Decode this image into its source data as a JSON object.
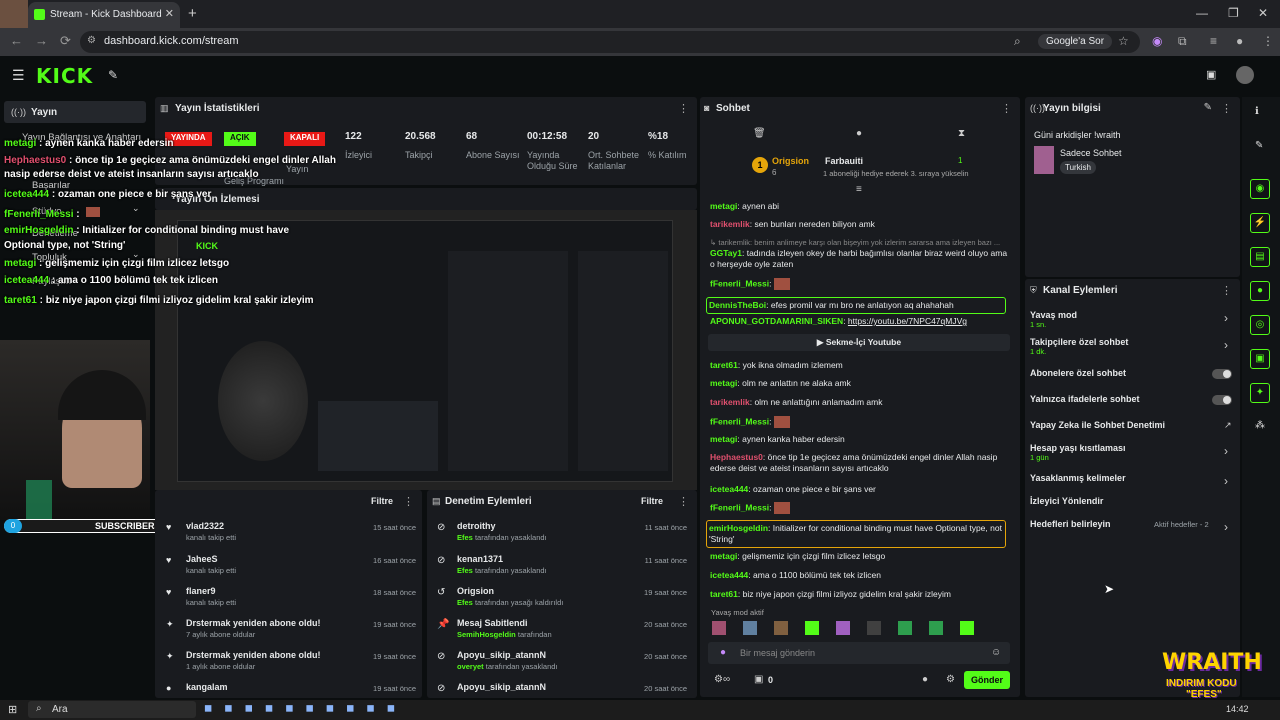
{
  "browser": {
    "tab_title": "Stream - Kick Dashboard",
    "url": "dashboard.kick.com/stream",
    "google_button": "Google'a Sor"
  },
  "kick": {
    "logo": "KICK"
  },
  "sidebar": {
    "active": "Yayın",
    "items": [
      "Yayın Bağlantısı ve Anahtarı",
      "Başarılar",
      "Stüdyo",
      "Topluluk",
      "Denetleme",
      "Paylaşım"
    ]
  },
  "stats": {
    "title": "Yayın İstatistikleri",
    "badges": [
      {
        "label": "YAYINDA",
        "color": "#e91916"
      },
      {
        "label": "AÇIK",
        "color": "#53fc18"
      },
      {
        "label": "KAPALI",
        "color": "#e91916"
      }
    ],
    "values": [
      {
        "v": "122",
        "l": "İzleyici"
      },
      {
        "v": "20.568",
        "l": "Takipçi"
      },
      {
        "v": "68",
        "l": "Abone Sayısı"
      },
      {
        "v": "00:12:58",
        "l": "Yayında Olduğu Süre"
      },
      {
        "v": "20",
        "l": "Ort. Sohbete Katılanlar"
      },
      {
        "v": "%18",
        "l": "% Katılım"
      }
    ],
    "sub_labels": [
      "Geliş Programı",
      "Yayın"
    ]
  },
  "preview": {
    "title": "Yayın Ön İzlemesi"
  },
  "activity": {
    "filter": "Filtre",
    "items": [
      {
        "name": "vlad2322",
        "sub": "kanalı takip etti",
        "time": "15 saat önce"
      },
      {
        "name": "JaheeS",
        "sub": "kanalı takip etti",
        "time": "16 saat önce"
      },
      {
        "name": "flaner9",
        "sub": "kanalı takip etti",
        "time": "18 saat önce"
      },
      {
        "name": "Drstermak yeniden abone oldu!",
        "sub": "7 aylık abone oldular",
        "time": "19 saat önce"
      },
      {
        "name": "Drstermak yeniden abone oldu!",
        "sub": "1 aylık abone oldular",
        "time": "19 saat önce"
      },
      {
        "name": "kangalam",
        "sub": "",
        "time": "19 saat önce"
      }
    ]
  },
  "moderation": {
    "title": "Denetim Eylemleri",
    "filter": "Filtre",
    "items": [
      {
        "name": "detroithy",
        "by": "Efes",
        "sub": "tarafından yasaklandı",
        "time": "11 saat önce"
      },
      {
        "name": "kenan1371",
        "by": "Efes",
        "sub": "tarafından yasaklandı",
        "time": "11 saat önce"
      },
      {
        "name": "Origsion",
        "by": "Efes",
        "sub": "tarafından yasağı kaldırıldı",
        "time": "19 saat önce"
      },
      {
        "name": "Mesaj Sabitlendi",
        "by": "SemihHosgeldin",
        "sub": "tarafından",
        "time": "20 saat önce"
      },
      {
        "name": "Apoyu_sikip_atannN",
        "by": "overyet",
        "sub": "tarafından yasaklandı",
        "time": "20 saat önce"
      },
      {
        "name": "Apoyu_sikip_atannN",
        "by": "",
        "sub": "",
        "time": "20 saat önce"
      }
    ]
  },
  "chat": {
    "title": "Sohbet",
    "gift": {
      "user1": "Origsion",
      "user2": "Farbauiti",
      "count1": "6",
      "count2": "1",
      "text": "1 aboneliği hediye ederek 3. sıraya yükselin"
    },
    "messages": [
      {
        "u": "metagi",
        "c": "#53fc18",
        "t": "aynen abi"
      },
      {
        "u": "tarikemlik",
        "c": "#e0506e",
        "t": "sen bunları nereden biliyon amk"
      },
      {
        "u": "",
        "c": "#888",
        "t": "↳ tarikemlik: benim anlimeye karşı olan bişeyim yok izlerim sararsa ama izleyen bazı ..."
      },
      {
        "u": "GGTay1",
        "c": "#53fc18",
        "t": "tadında izleyen okey de harbi bağımlısı olanlar biraz weird oluyo ama o herşeyde oyle zaten"
      },
      {
        "u": "fFenerli_Messi",
        "c": "#53fc18",
        "t": ""
      },
      {
        "u": "DennisTheBoi",
        "c": "#53fc18",
        "t": "efes promil var mı bro ne anlatıyon aq ahahahah"
      },
      {
        "u": "APONUN_GOTDAMARINI_SIKEN",
        "c": "#53fc18",
        "t": "https://youtu.be/7NPC47qMJVg"
      },
      {
        "u": "taret61",
        "c": "#53fc18",
        "t": "yok ikna olmadım izlemem"
      },
      {
        "u": "metagi",
        "c": "#53fc18",
        "t": "olm ne anlattın ne alaka amk"
      },
      {
        "u": "tarikemlik",
        "c": "#e0506e",
        "t": "olm ne anlattığını anlamadım amk"
      },
      {
        "u": "fFenerli_Messi",
        "c": "#53fc18",
        "t": ""
      },
      {
        "u": "metagi",
        "c": "#53fc18",
        "t": "aynen kanka haber edersin"
      },
      {
        "u": "Hephaestus0",
        "c": "#e0506e",
        "t": "önce tip 1e geçicez ama önümüzdeki engel dinler Allah nasip ederse deist ve ateist insanların sayısı artıcaklo"
      },
      {
        "u": "icetea444",
        "c": "#53fc18",
        "t": "ozaman one piece e bir şans ver"
      },
      {
        "u": "fFenerli_Messi",
        "c": "#53fc18",
        "t": ""
      },
      {
        "u": "emirHosgeldin",
        "c": "#53fc18",
        "t": "Initializer for conditional binding must have Optional type, not 'String'"
      },
      {
        "u": "metagi",
        "c": "#53fc18",
        "t": "gelişmemiz için çizgi film izlicez letsgo"
      },
      {
        "u": "icetea444",
        "c": "#53fc18",
        "t": "ama o 1100 bölümü tek tek izlicen"
      },
      {
        "u": "taret61",
        "c": "#53fc18",
        "t": "biz niye japon çizgi filmi izliyoz gidelim kral şakir izleyim"
      }
    ],
    "youtube_button": "Sekme-İçi Youtube",
    "slow_mode": "Yavaş mod aktif",
    "placeholder": "Bir mesaj gönderin",
    "send": "Gönder",
    "count": "0"
  },
  "info": {
    "title": "Yayın bilgisi",
    "stream_title": "Güni arkidişler !wraith",
    "category": "Sadece Sohbet",
    "tag": "Turkish"
  },
  "channel_actions": {
    "title": "Kanal Eylemleri",
    "items": [
      {
        "name": "Yavaş mod",
        "sub": "1 sn.",
        "kind": "chevron"
      },
      {
        "name": "Takipçilere özel sohbet",
        "sub": "1 dk.",
        "kind": "chevron"
      },
      {
        "name": "Abonelere özel sohbet",
        "sub": "",
        "kind": "toggle"
      },
      {
        "name": "Yalnızca ifadelerle sohbet",
        "sub": "",
        "kind": "toggle"
      },
      {
        "name": "Yapay Zeka ile Sohbet Denetimi",
        "sub": "",
        "kind": "ext"
      },
      {
        "name": "Hesap yaşı kısıtlaması",
        "sub": "1 gün",
        "kind": "chevron"
      },
      {
        "name": "Yasaklanmış kelimeler",
        "sub": "",
        "kind": "chevron"
      },
      {
        "name": "İzleyici Yönlendir",
        "sub": "",
        "kind": "none"
      },
      {
        "name": "Hedefleri belirleyin",
        "sub": "",
        "kind": "chevron",
        "status": "Aktif hedefler - 2"
      }
    ]
  },
  "overlay": {
    "chat": [
      {
        "u": "metagi",
        "c": "#53fc18",
        "t": "aynen kanka haber edersin"
      },
      {
        "u": "Hephaestus0",
        "c": "#e0506e",
        "t": "önce tip 1e geçicez ama önümüzdeki engel dinler Allah"
      },
      {
        "u": "",
        "c": "#fff",
        "t": "nasip ederse deist ve ateist insanların sayısı artıcaklo"
      },
      {
        "u": "icetea444",
        "c": "#53fc18",
        "t": "ozaman one piece e bir şans ver"
      },
      {
        "u": "fFenerli_Messi",
        "c": "#53fc18",
        "t": ""
      },
      {
        "u": "emirHosgeldin",
        "c": "#53fc18",
        "t": "Initializer for conditional binding must have"
      },
      {
        "u": "",
        "c": "#fff",
        "t": "Optional type, not 'String'"
      },
      {
        "u": "metagi",
        "c": "#53fc18",
        "t": "gelişmemiz için çizgi film izlicez letsgo"
      },
      {
        "u": "icetea444",
        "c": "#53fc18",
        "t": "ama o 1100 bölümü tek tek izlicen"
      },
      {
        "u": "taret61",
        "c": "#53fc18",
        "t": "biz niye japon çizgi filmi izliyoz gidelim kral şakir izleyim"
      }
    ],
    "subscribers": "SUBSCRIBERS",
    "sub_count": "7",
    "sub_zero": "0",
    "brand": "WRAITH",
    "brand_sub": "INDIRIM KODU",
    "brand_code": "\"EFES\""
  },
  "taskbar": {
    "search": "Ara",
    "time": "14:42"
  }
}
